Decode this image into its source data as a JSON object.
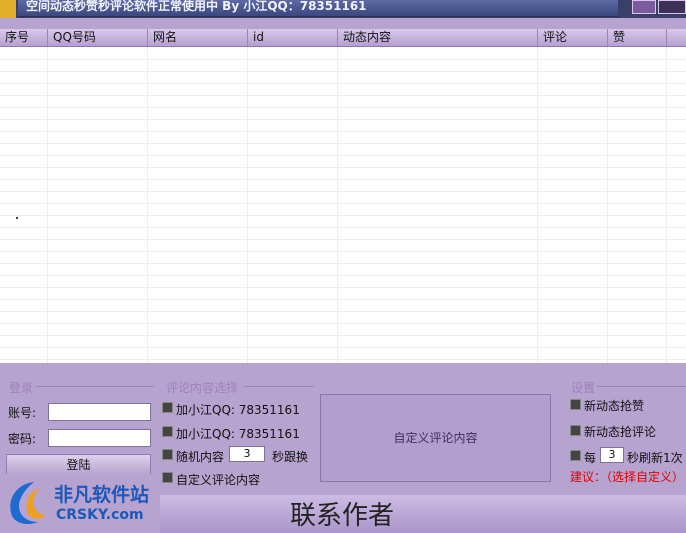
{
  "window": {
    "title": "空间动态秒赞秒评论软件正常使用中 By 小江QQ：78351161"
  },
  "list": {
    "columns": [
      "序号",
      "QQ号码",
      "网名",
      "id",
      "动态内容",
      "评论",
      "赞"
    ]
  },
  "login": {
    "group_title": "登录",
    "account_label": "账号:",
    "account_value": "",
    "password_label": "密码:",
    "password_value": "",
    "login_button": "登陆"
  },
  "comment_select": {
    "group_title": "评论内容选择",
    "option1": "加小江QQ: 78351161",
    "option2": "加小江QQ: 78351161",
    "option3_prefix": "随机内容",
    "option3_value": "3",
    "option3_suffix": "秒跟换",
    "option4": "自定义评论内容",
    "custom_area": "自定义评论内容"
  },
  "settings": {
    "group_title": "设置",
    "option1": "新动态抢赞",
    "option2": "新动态抢评论",
    "refresh_prefix": "每",
    "refresh_value": "3",
    "refresh_suffix": "秒刷新1次",
    "suggestion": "建议：（选择自定义）"
  },
  "contact": {
    "label": "联系作者"
  },
  "watermark": {
    "cn": "非凡软件站",
    "en": "CRSKY.com"
  }
}
